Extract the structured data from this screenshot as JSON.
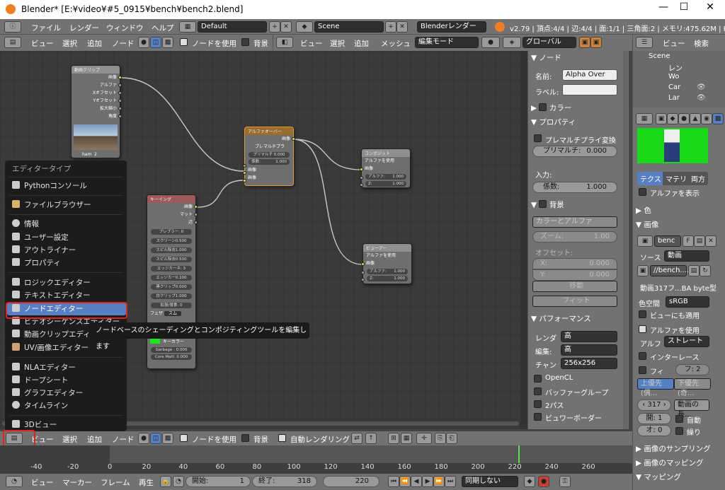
{
  "window": {
    "title": "Blender* [E:¥video¥#5_0915¥bench¥bench2.blend]",
    "minimize": "—",
    "maximize": "☐",
    "close": "✕"
  },
  "topbar": {
    "menus": [
      "ファイル",
      "レンダー",
      "ウィンドウ",
      "ヘルプ"
    ],
    "layout": "Default",
    "scene": "Scene",
    "engine": "Blenderレンダー",
    "stats": "v2.79 | 頂点:4/4 | 辺:4/4 | 面:1/1 | 三角面:2 | メモリ:475.62M | Plane.00"
  },
  "node_header": {
    "menus": [
      "ビュー",
      "選択",
      "追加",
      "ノード"
    ],
    "use_nodes": "ノードを使用",
    "backdrop": "背景"
  },
  "view3d_header": {
    "menus": [
      "ビュー",
      "選択",
      "追加",
      "メッシュ"
    ],
    "mode": "編集モード",
    "orientation": "グローバル"
  },
  "outliner": {
    "menus": [
      "ビュー",
      "検索"
    ],
    "items": [
      "Scene",
      "レン",
      "Wo",
      "Car",
      "Lar"
    ]
  },
  "nodes": {
    "clip": {
      "title": "動画クリップ",
      "outs": [
        "画像",
        "アルファ",
        "Xオフセット",
        "Yオフセット",
        "拡大縮小",
        "角度"
      ],
      "name": "ham",
      "users": "2"
    },
    "alpha": {
      "title": "アルファオーバー",
      "out": "画像",
      "premul_label": "プレマルチプラ",
      "premul_field": "プリマルチ 0.000",
      "factor": "係数:",
      "factor_val": "1.000",
      "in1": "画像",
      "in2": "画像"
    },
    "composite": {
      "title": "コンポジット",
      "use_alpha": "アルファを使用",
      "in": "画像",
      "alpha_lbl": "アルファ:",
      "alpha_val": "1.000",
      "z_lbl": "Z:",
      "z_val": "1.000"
    },
    "viewer": {
      "title": "ビューアー",
      "use_alpha": "アルファを使用",
      "in": "画像",
      "alpha_lbl": "アルファ:",
      "alpha_val": "1.000",
      "z_lbl": "Z:",
      "z_val": "1.000"
    },
    "keying": {
      "title": "キーイング",
      "outs": [
        "画像",
        "マット",
        "辺"
      ],
      "fields": [
        "プレブラー: 0",
        "スクリーン0.500",
        "スピル除去1.000",
        "スピル除去0.500",
        "エッジカーネ: 3",
        "エッジカー0.100",
        "黒クリップ0.000",
        "白クリップ1.000",
        "拡張/侵食: 0"
      ],
      "feather": "フェザ",
      "feather_val": "スム",
      "key_color": "キーカラー",
      "garbage": "Garbage : 0.000",
      "core": "Core Matt: 0.000",
      "in": "画像"
    }
  },
  "editor_menu": {
    "heading": "エディタータイプ",
    "items": [
      "Pythonコンソール",
      "ファイルブラウザー",
      "情報",
      "ユーザー設定",
      "アウトライナー",
      "プロパティ",
      "ロジックエディター",
      "テキストエディター",
      "ノードエディター",
      "ビデオシーケンスエディター",
      "動画クリップエディター",
      "UV/画像エディター",
      "NLAエディター",
      "ドープシート",
      "グラフエディター",
      "タイムライン",
      "3Dビュー"
    ]
  },
  "tooltip": "ノードベースのシェーディングとコンポジティングツールを編集します",
  "props": {
    "node_head": "ノード",
    "name_lbl": "名前:",
    "name_val": "Alpha Over",
    "label_lbl": "ラベル:",
    "color_head": "カラー",
    "prop_head": "プロパティ",
    "premul_chk": "プレマルチプライ変換",
    "premul": "プリマルチ:",
    "premul_val": "0.000",
    "input_lbl": "入力:",
    "factor": "係数:",
    "factor_val": "1.000",
    "bg_head": "背景",
    "bg_mode": "カラーとアルファ",
    "zoom": "ズーム:",
    "zoom_val": "1.00",
    "offset": "オフセット:",
    "x": "X:",
    "x_val": "0.000",
    "y": "Y:",
    "y_val": "0.000",
    "move": "移動",
    "fit": "フィット",
    "perf_head": "パフォーマンス",
    "render_lbl": "レンダ",
    "render_val": "高",
    "edit_lbl": "編集:",
    "edit_val": "高",
    "chan_lbl": "チャン",
    "chan_val": "256x256",
    "opencl": "OpenCL",
    "buffer": "バッファーグループ",
    "twopass": "2パス",
    "viewer_border": "ビュワーボーダー"
  },
  "texpanel": {
    "tabs": [
      "テクス",
      "マテリ",
      "両方"
    ],
    "show_alpha": "アルファを表示",
    "color_head": "色",
    "image_head": "画像",
    "img_name": "benc",
    "img_flag": "F",
    "source_lbl": "ソース",
    "source_val": "動画",
    "file": "//bench....",
    "info": "動画317フ...BA byte型",
    "colorspace_lbl": "色空間",
    "colorspace_val": "sRGB",
    "view_as_render": "ビューにも適用",
    "use_alpha": "アルファを使用",
    "alpha_lbl": "アルフ",
    "alpha_val": "ストレート",
    "interlace": "インターレース",
    "fields": "フィ",
    "fields_val": "フ: 2",
    "upper": "上優先(偶...",
    "lower": "下優先(奇...",
    "frames": "317",
    "length": "動画の長...",
    "start": "開: 1",
    "auto": "自動",
    "offset": "オ: 0",
    "cyclic": "繰り",
    "sampling": "画像のサンプリング",
    "mapping": "画像のマッピング",
    "mapping2": "マッピング"
  },
  "node_footer": {
    "menus": [
      "ビュー",
      "選択",
      "追加",
      "ノード"
    ],
    "use_nodes": "ノードを使用",
    "backdrop": "背景",
    "auto_render": "自動レンダリング"
  },
  "timeline": {
    "ticks": [
      "-40",
      "-20",
      "0",
      "20",
      "40",
      "60",
      "80",
      "100",
      "120",
      "140",
      "160",
      "180",
      "200",
      "220",
      "240",
      "260"
    ],
    "current_frame": 222
  },
  "bottom": {
    "menus": [
      "ビュー",
      "マーカー",
      "フレーム",
      "再生"
    ],
    "start_lbl": "開始:",
    "start_val": "1",
    "end_lbl": "終了:",
    "end_val": "318",
    "current": "220",
    "sync": "同期しない"
  }
}
